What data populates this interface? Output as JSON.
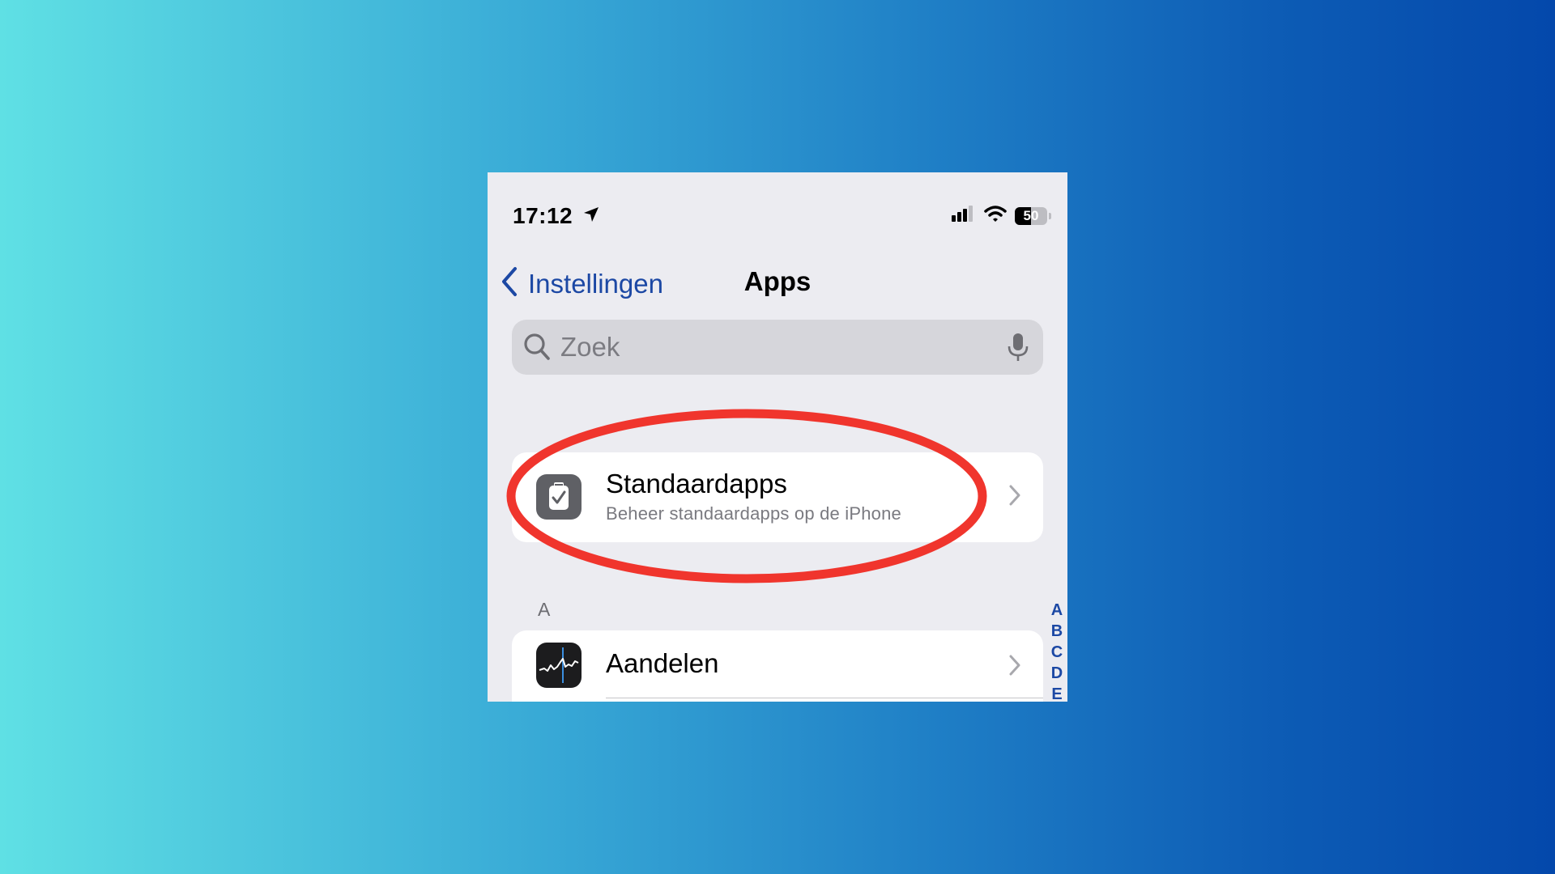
{
  "status_bar": {
    "time": "17:12",
    "battery_level": "50",
    "battery_fraction": 0.5,
    "icons": [
      "location-arrow-icon",
      "cellular-signal-icon",
      "wifi-icon",
      "battery-icon"
    ]
  },
  "nav": {
    "back_label": "Instellingen",
    "title": "Apps"
  },
  "search": {
    "placeholder": "Zoek",
    "value": ""
  },
  "default_apps": {
    "title": "Standaardapps",
    "subtitle": "Beheer standaardapps op de iPhone",
    "icon": "default-apps-icon"
  },
  "sections": [
    {
      "header": "A",
      "items": [
        {
          "label": "Aandelen",
          "icon": "stocks-icon"
        }
      ]
    }
  ],
  "index_letters": [
    "A",
    "B",
    "C",
    "D",
    "E"
  ],
  "colors": {
    "accent": "#1c48a4",
    "highlight": "#f0352d",
    "background_grouped": "#ececf1"
  }
}
